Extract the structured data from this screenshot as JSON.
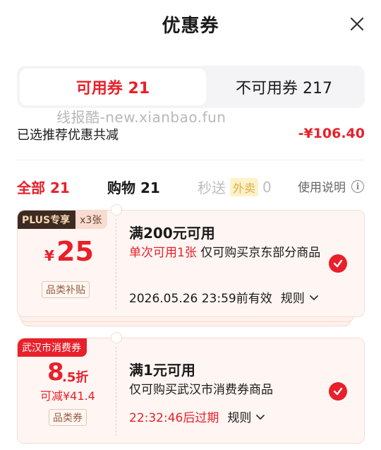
{
  "header": {
    "title": "优惠券",
    "close_icon": "close-icon"
  },
  "tabs": {
    "available": "可用券 21",
    "unavailable": "不可用券 217"
  },
  "watermark": "线报酷-new.xianbao.fun",
  "summary": {
    "label": "已选推荐优惠共减",
    "amount": "-¥106.40"
  },
  "filters": {
    "all": "全部 21",
    "shopping": "购物 21",
    "flash_prefix": "秒送",
    "flash_tag": "外卖",
    "flash_count": "0",
    "help": "使用说明",
    "help_icon": "info-icon"
  },
  "coupons": [
    {
      "badge_a": "PLUS专享",
      "badge_b": "x3张",
      "currency": "¥",
      "amount": "25",
      "tag": "品类补贴",
      "title": "满200元可用",
      "desc_red": "单次可用1张",
      "desc_rest": "仅可购买京东部分商品",
      "validity": "2026.05.26 23:59前有效",
      "rule": "规则",
      "selected": true
    },
    {
      "badge": "武汉市消费券",
      "discount_main": "8",
      "discount_sub": ".5折",
      "reduce": "可减¥41.4",
      "tag": "品类券",
      "title": "满1元可用",
      "desc_rest": "仅可购买武汉市消费券商品",
      "expire": "22:32:46后过期",
      "rule": "规则",
      "selected": true
    }
  ],
  "colors": {
    "accent": "#e8202a",
    "card_bg": "#fff6f3",
    "segment_bg": "#f4f4f6"
  }
}
